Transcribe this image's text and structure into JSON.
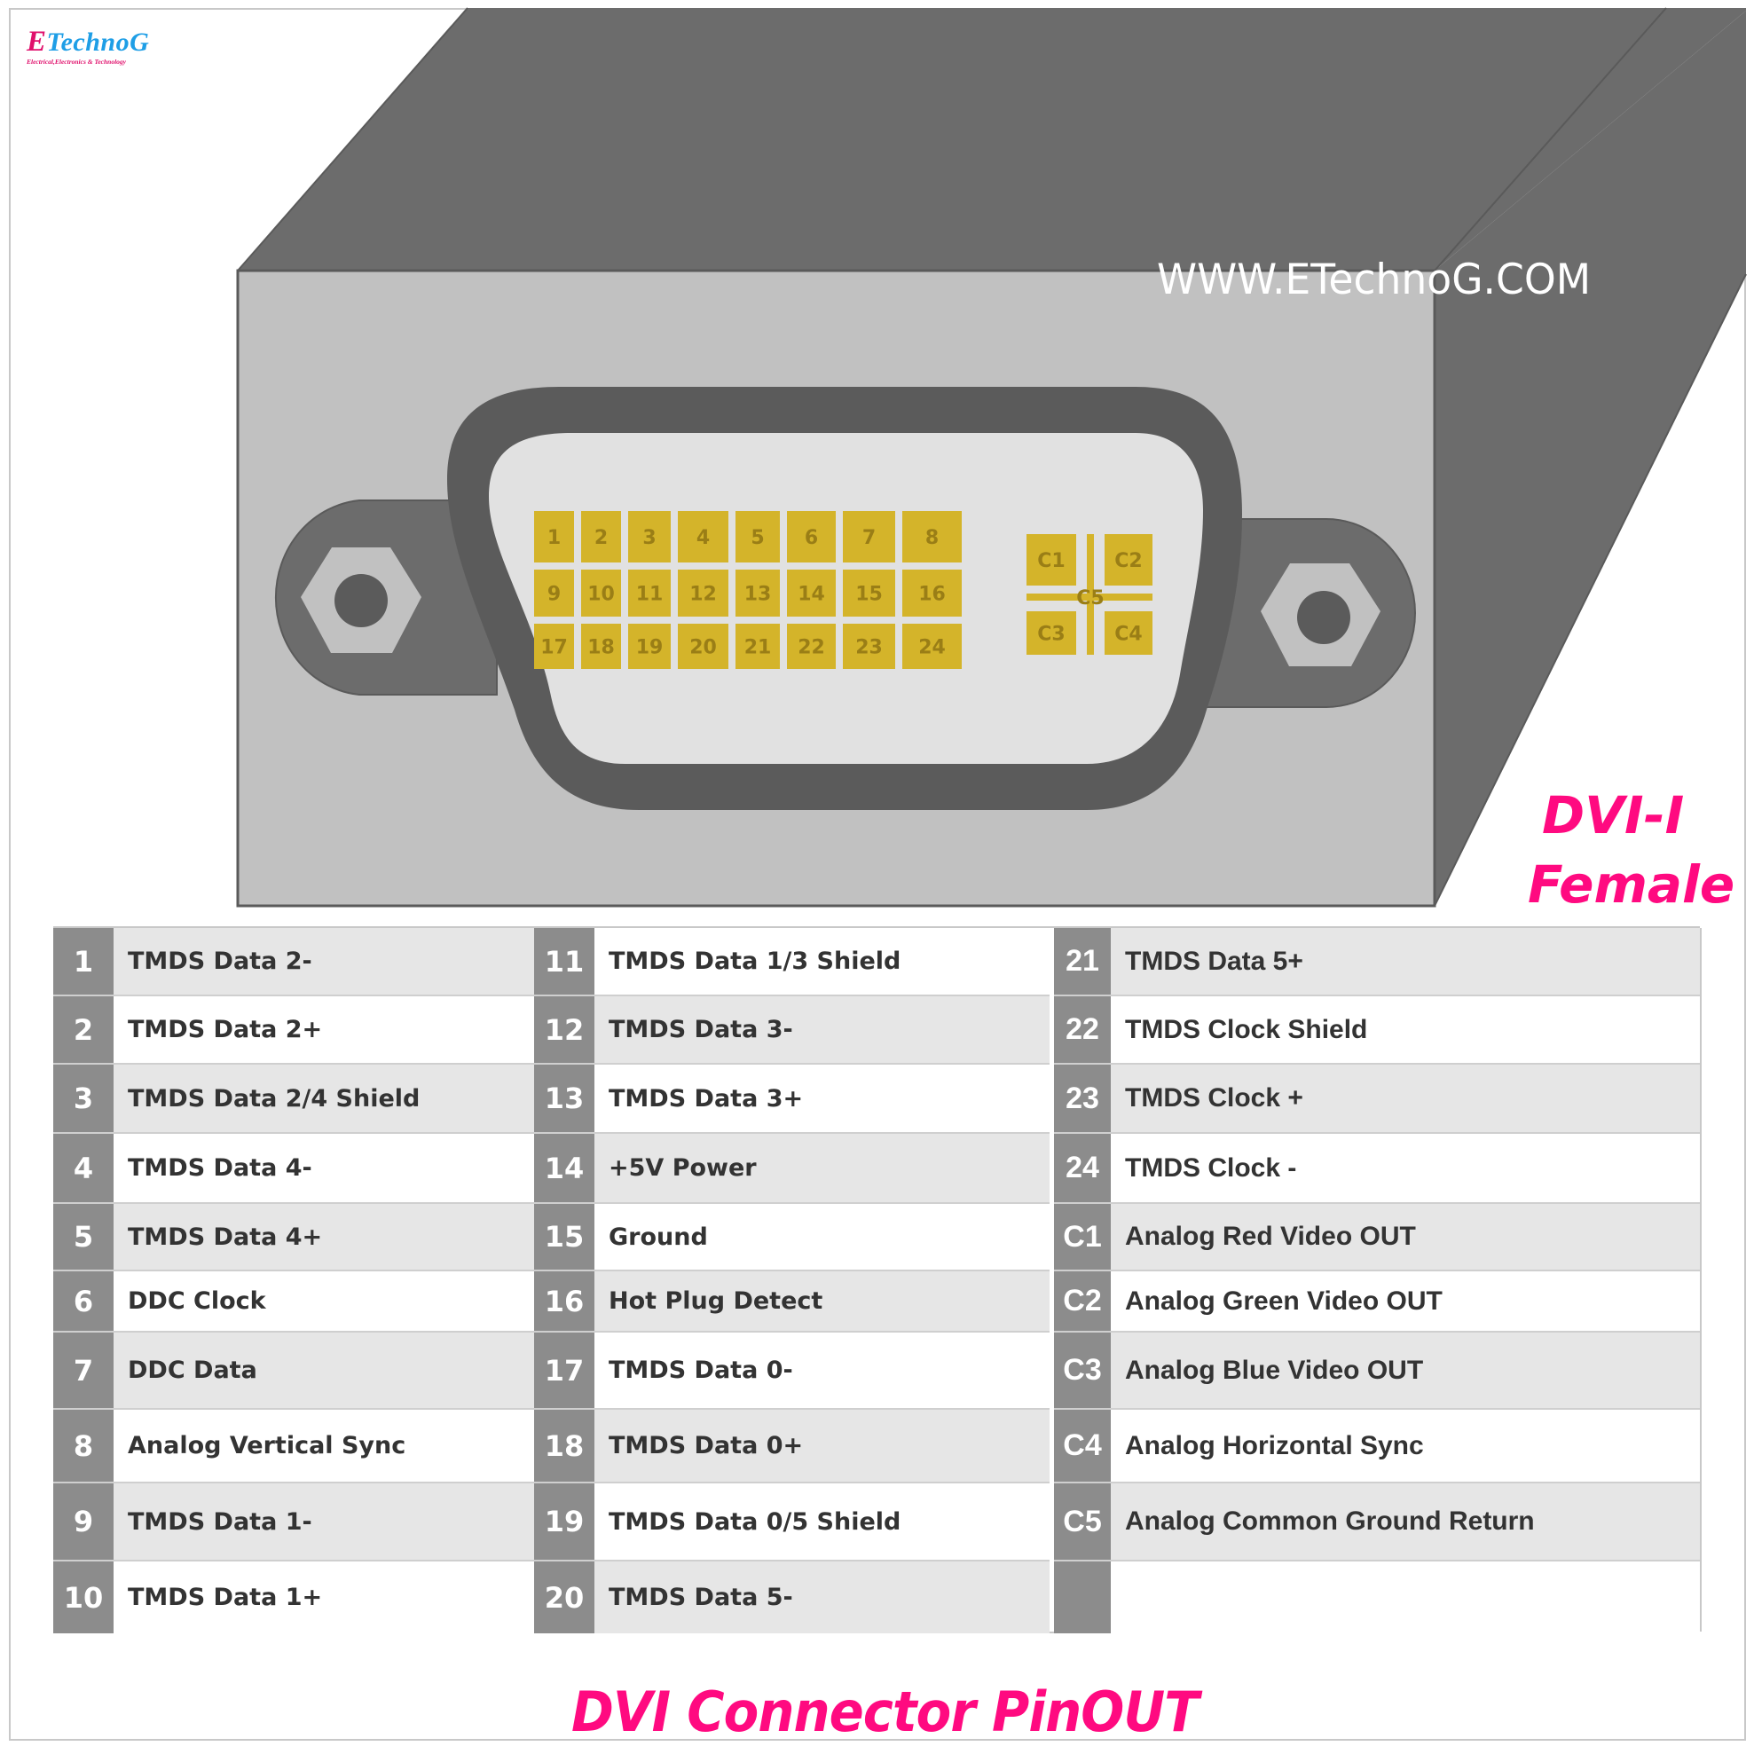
{
  "logo": {
    "letter": "E",
    "name": "TechnoG",
    "tagline": "Electrical,Electronics & Technology"
  },
  "watermark": "WWW.ETechnoG.COM",
  "badge": {
    "line1": "DVI-I",
    "line2": "Female"
  },
  "footer_title": "DVI Connector PinOUT",
  "colors": {
    "accent_pink": "#ff0a80",
    "logo_blue": "#1e9ee6",
    "pin_gold": "#d4b42a",
    "pin_text": "#9a7e16",
    "box_dark": "#6c6c6c",
    "box_front": "#c1c1c1",
    "shell_dark": "#5b5b5b",
    "shell_inner": "#e1e1e1",
    "ear": "#6c6c6c",
    "table_num_bg": "#8c8c8c",
    "table_row_grey": "#e6e6e6"
  },
  "connector": {
    "digital_pin_rows": [
      [
        "1",
        "2",
        "3",
        "4",
        "5",
        "6",
        "7",
        "8"
      ],
      [
        "9",
        "10",
        "11",
        "12",
        "13",
        "14",
        "15",
        "16"
      ],
      [
        "17",
        "18",
        "19",
        "20",
        "21",
        "22",
        "23",
        "24"
      ]
    ],
    "analog_pins": [
      "C1",
      "C2",
      "C3",
      "C4",
      "C5"
    ],
    "screw_icons": [
      "left-screw",
      "right-screw"
    ]
  },
  "pinout": {
    "columns": [
      [
        {
          "pin": "1",
          "signal": "TMDS Data 2-"
        },
        {
          "pin": "2",
          "signal": "TMDS Data 2+"
        },
        {
          "pin": "3",
          "signal": "TMDS Data 2/4 Shield"
        },
        {
          "pin": "4",
          "signal": "TMDS Data 4-"
        },
        {
          "pin": "5",
          "signal": "TMDS Data 4+"
        },
        {
          "pin": "6",
          "signal": "DDC Clock"
        },
        {
          "pin": "7",
          "signal": "DDC Data"
        },
        {
          "pin": "8",
          "signal": "Analog Vertical Sync"
        },
        {
          "pin": "9",
          "signal": "TMDS Data 1-"
        },
        {
          "pin": "10",
          "signal": "TMDS Data 1+"
        }
      ],
      [
        {
          "pin": "11",
          "signal": "TMDS Data 1/3 Shield"
        },
        {
          "pin": "12",
          "signal": "TMDS Data 3-"
        },
        {
          "pin": "13",
          "signal": "TMDS Data 3+"
        },
        {
          "pin": "14",
          "signal": "+5V Power"
        },
        {
          "pin": "15",
          "signal": "Ground"
        },
        {
          "pin": "16",
          "signal": "Hot Plug Detect"
        },
        {
          "pin": "17",
          "signal": "TMDS Data 0-"
        },
        {
          "pin": "18",
          "signal": "TMDS Data 0+"
        },
        {
          "pin": "19",
          "signal": "TMDS Data 0/5 Shield"
        },
        {
          "pin": "20",
          "signal": "TMDS Data 5-"
        }
      ],
      [
        {
          "pin": "21",
          "signal": "TMDS Data 5+"
        },
        {
          "pin": "22",
          "signal": "TMDS Clock Shield"
        },
        {
          "pin": "23",
          "signal": "TMDS Clock +"
        },
        {
          "pin": "24",
          "signal": "TMDS Clock -"
        },
        {
          "pin": "C1",
          "signal": "Analog Red Video OUT"
        },
        {
          "pin": "C2",
          "signal": "Analog Green Video OUT"
        },
        {
          "pin": "C3",
          "signal": "Analog Blue Video OUT"
        },
        {
          "pin": "C4",
          "signal": "Analog Horizontal Sync"
        },
        {
          "pin": "C5",
          "signal": "Analog Common Ground Return"
        },
        {
          "pin": "",
          "signal": ""
        }
      ]
    ]
  }
}
